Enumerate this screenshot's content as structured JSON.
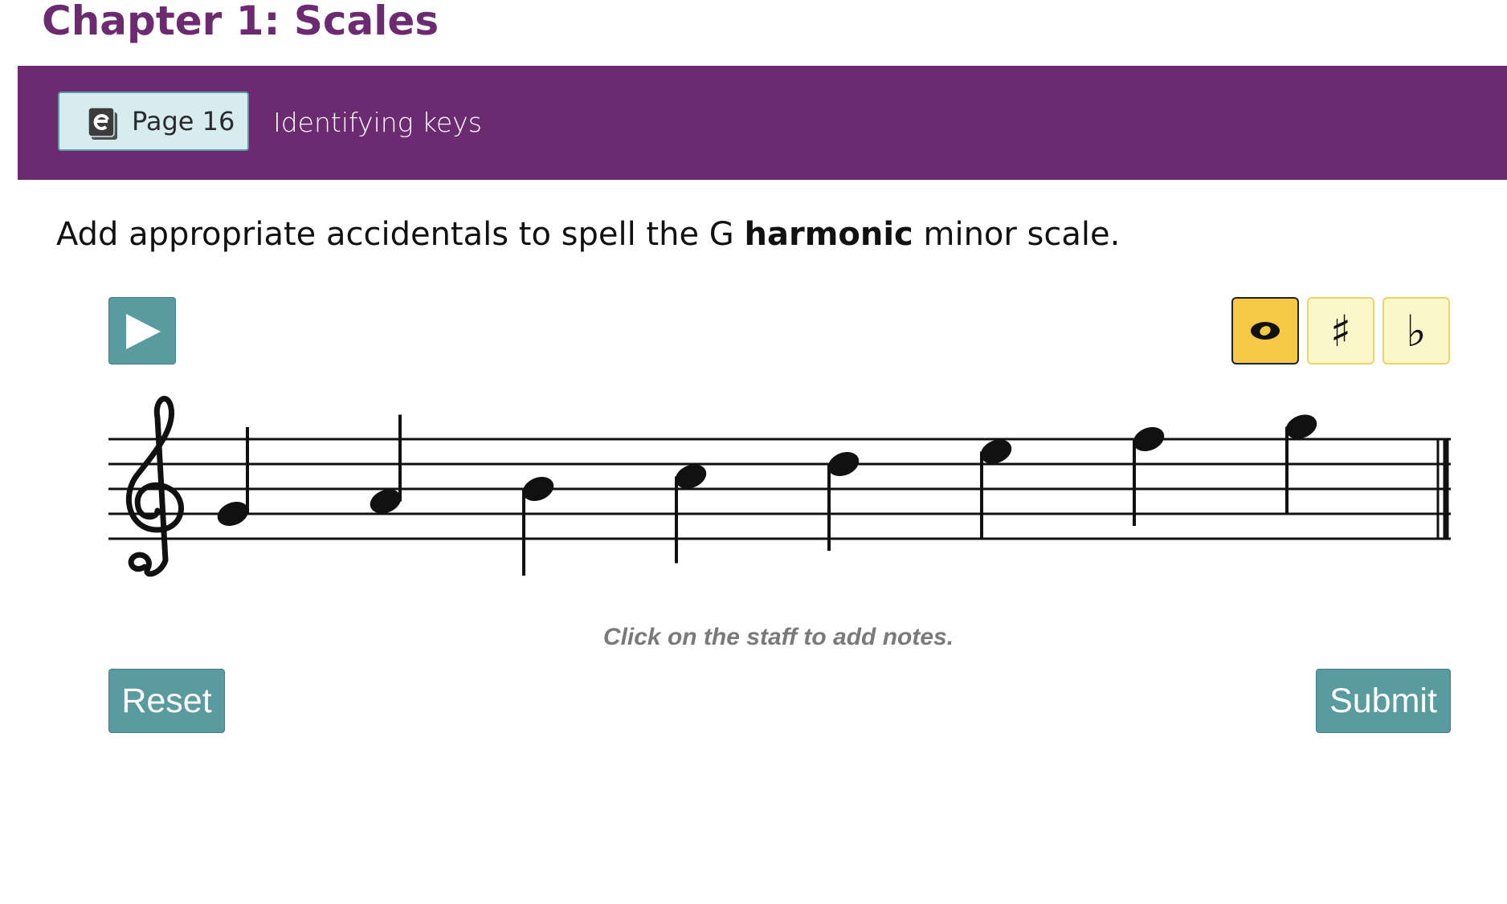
{
  "chapter": {
    "title": "Chapter 1: Scales"
  },
  "banner": {
    "page_button_label": "Page 16",
    "page_button_icon": "ebook-icon",
    "section_label": "Identifying keys"
  },
  "instruction": {
    "before": "Add appropriate accidentals to spell the G ",
    "bold": "harmonic",
    "after": " minor scale."
  },
  "player": {
    "play_icon": "play-icon"
  },
  "tools": [
    {
      "name": "note",
      "symbol": "whole-note-icon",
      "selected": true
    },
    {
      "name": "sharp",
      "symbol": "♯",
      "selected": false
    },
    {
      "name": "flat",
      "symbol": "♭",
      "selected": false
    }
  ],
  "staff": {
    "clef": "treble",
    "notes": [
      "G4",
      "A4",
      "B4",
      "C5",
      "D5",
      "E5",
      "F5",
      "G5"
    ]
  },
  "hint": "Click on the staff to add notes.",
  "buttons": {
    "reset": "Reset",
    "submit": "Submit"
  },
  "colors": {
    "brand_purple": "#6c2b70",
    "teal": "#5a9ba0",
    "tool_selected": "#f6c945",
    "tool_unselected": "#fdf8cc"
  }
}
